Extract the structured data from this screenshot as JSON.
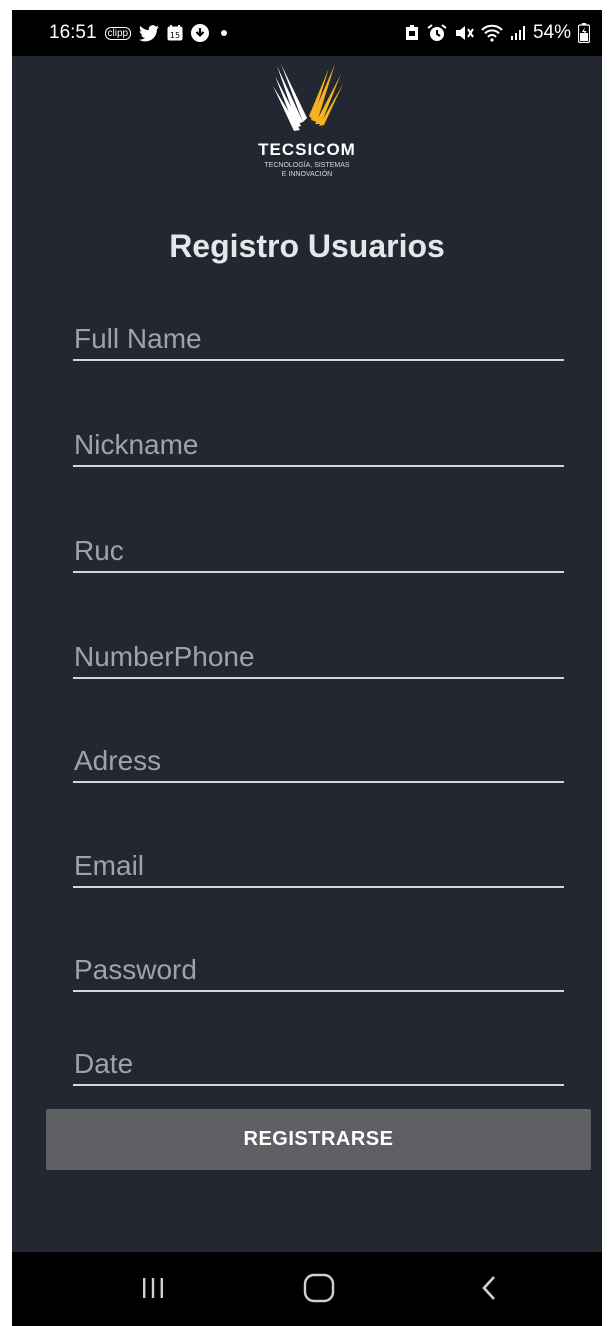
{
  "status_bar": {
    "time": "16:51",
    "clipp_label": "clipp",
    "calendar_day": "15",
    "battery_percent": "54%",
    "icons_left": [
      "twitter-icon",
      "calendar-icon",
      "download-icon",
      "dot-icon"
    ],
    "icons_right": [
      "screenshot-icon",
      "alarm-icon",
      "mute-icon",
      "wifi-icon",
      "signal-icon",
      "battery-icon"
    ]
  },
  "brand": {
    "name": "TECSICOM",
    "tagline_line1": "TECNOLOGÍA, SISTEMAS",
    "tagline_line2": "E INNOVACIÓN",
    "colors": {
      "wing_white": "#ffffff",
      "wing_gold": "#f5b41f"
    }
  },
  "page": {
    "title": "Registro Usuarios",
    "background": "#222731"
  },
  "form": {
    "fields": [
      {
        "placeholder": "Full Name",
        "value": ""
      },
      {
        "placeholder": "Nickname",
        "value": ""
      },
      {
        "placeholder": "Ruc",
        "value": ""
      },
      {
        "placeholder": "NumberPhone",
        "value": ""
      },
      {
        "placeholder": "Adress",
        "value": ""
      },
      {
        "placeholder": "Email",
        "value": ""
      },
      {
        "placeholder": "Password",
        "value": ""
      },
      {
        "placeholder": "Date",
        "value": ""
      }
    ],
    "submit_label": "REGISTRARSE",
    "submit_color": "#5f6063"
  },
  "nav_bar": {
    "buttons": [
      "recent-apps-icon",
      "home-icon",
      "back-icon"
    ]
  }
}
